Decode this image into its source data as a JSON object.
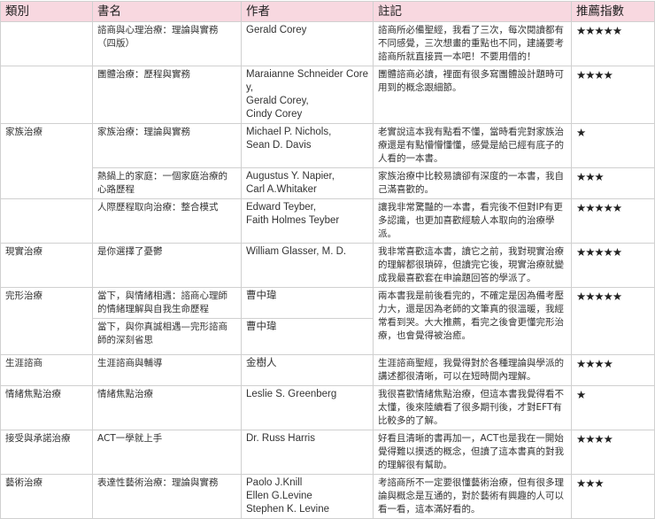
{
  "headers": [
    "類別",
    "書名",
    "作者",
    "註記",
    "推薦指數"
  ],
  "rows": [
    {
      "category": "",
      "title": "諮商與心理治療：理論與實務（四版）",
      "authors": [
        "Gerald Corey"
      ],
      "note": "諮商所必備聖經，我看了三次，每次閱讀都有不同感覺，三次想畫的重點也不同，建議要考諮商所就直接買一本吧！不要用借的！",
      "stars": "★★★★★"
    },
    {
      "category": "",
      "title": "團體治療：歷程與實務",
      "authors": [
        "Maraianne Schneider Corey,",
        "Gerald Corey,",
        "Cindy Corey"
      ],
      "note": "團體諮商必讀，裡面有很多寫團體設計題時可用到的概念跟細節。",
      "stars": "★★★★"
    },
    {
      "category": "家族治療",
      "title": "家族治療：理論與實務",
      "authors": [
        "Michael P. Nichols,",
        "Sean D. Davis"
      ],
      "note": "老實說這本我有點看不懂，當時看完對家族治療還是有點懵懵懂懂，感覺是給已經有底子的人看的一本書。",
      "stars": "★"
    },
    {
      "category": "",
      "title": "熱鍋上的家庭：一個家庭治療的心路歷程",
      "authors": [
        "Augustus Y. Napier,",
        "Carl A.Whitaker"
      ],
      "note": "家族治療中比較易讀卻有深度的一本書，我自己滿喜歡的。",
      "stars": "★★★"
    },
    {
      "category": "",
      "title": "人際歷程取向治療：整合模式",
      "authors": [
        "Edward Teyber,",
        "Faith Holmes Teyber"
      ],
      "note": "讓我非常驚豔的一本書，看完後不但對IP有更多認識，也更加喜歡經驗人本取向的治療學派。",
      "stars": "★★★★★"
    },
    {
      "category": "現實治療",
      "title": "是你選擇了憂鬱",
      "authors": [
        "William Glasser, M. D."
      ],
      "note": "我非常喜歡這本書，讀它之前，我對現實治療的理解都很瑣碎，但讀完它後，現實治療就變成我最喜歡套在申論題回答的學派了。",
      "stars": "★★★★★"
    },
    {
      "category": "完形治療",
      "title": "當下，與情緒相遇：諮商心理師的情緒理解與自我生命歷程",
      "authors": [
        "曹中瑋"
      ],
      "note": "兩本書我是前後看完的，不確定是因為備考壓力大，還是因為老師的文筆真的很溫暖，我經常看到哭。大大推薦，看完之後會更懂完形治療，也會覺得被治癒。",
      "stars": "★★★★★"
    },
    {
      "category": "",
      "title": "當下，與你真誠相遇—完形諮商師的深刻省思",
      "authors": [
        "曹中瑋"
      ],
      "note": "",
      "stars": ""
    },
    {
      "category": "生涯諮商",
      "title": "生涯諮商與輔導",
      "authors": [
        "金樹人"
      ],
      "note": "生涯諮商聖經，我覺得對於各種理論與學派的講述都很清晰，可以在短時間內理解。",
      "stars": "★★★★"
    },
    {
      "category": "情緒焦點治療",
      "title": "情緒焦點治療",
      "authors": [
        "Leslie S. Greenberg"
      ],
      "note": "我很喜歡情緒焦點治療，但這本書我覺得看不太懂，後來陸續看了很多期刊後，才對EFT有比較多的了解。",
      "stars": "★"
    },
    {
      "category": "接受與承諾治療",
      "title": "ACT一學就上手",
      "authors": [
        "Dr. Russ Harris"
      ],
      "note": "好看且清晰的書再加一，ACT也是我在一開始覺得難以摸透的概念，但讀了這本書真的對我的理解很有幫助。",
      "stars": "★★★★"
    },
    {
      "category": "藝術治療",
      "title": "表達性藝術治療：理論與實務",
      "authors": [
        "Paolo J.Knill",
        "Ellen G.Levine",
        "Stephen K. Levine"
      ],
      "note": "考諮商所不一定要很懂藝術治療，但有很多理論與概念是互通的，對於藝術有興趣的人可以看一看，這本滿好看的。",
      "stars": "★★★"
    }
  ]
}
